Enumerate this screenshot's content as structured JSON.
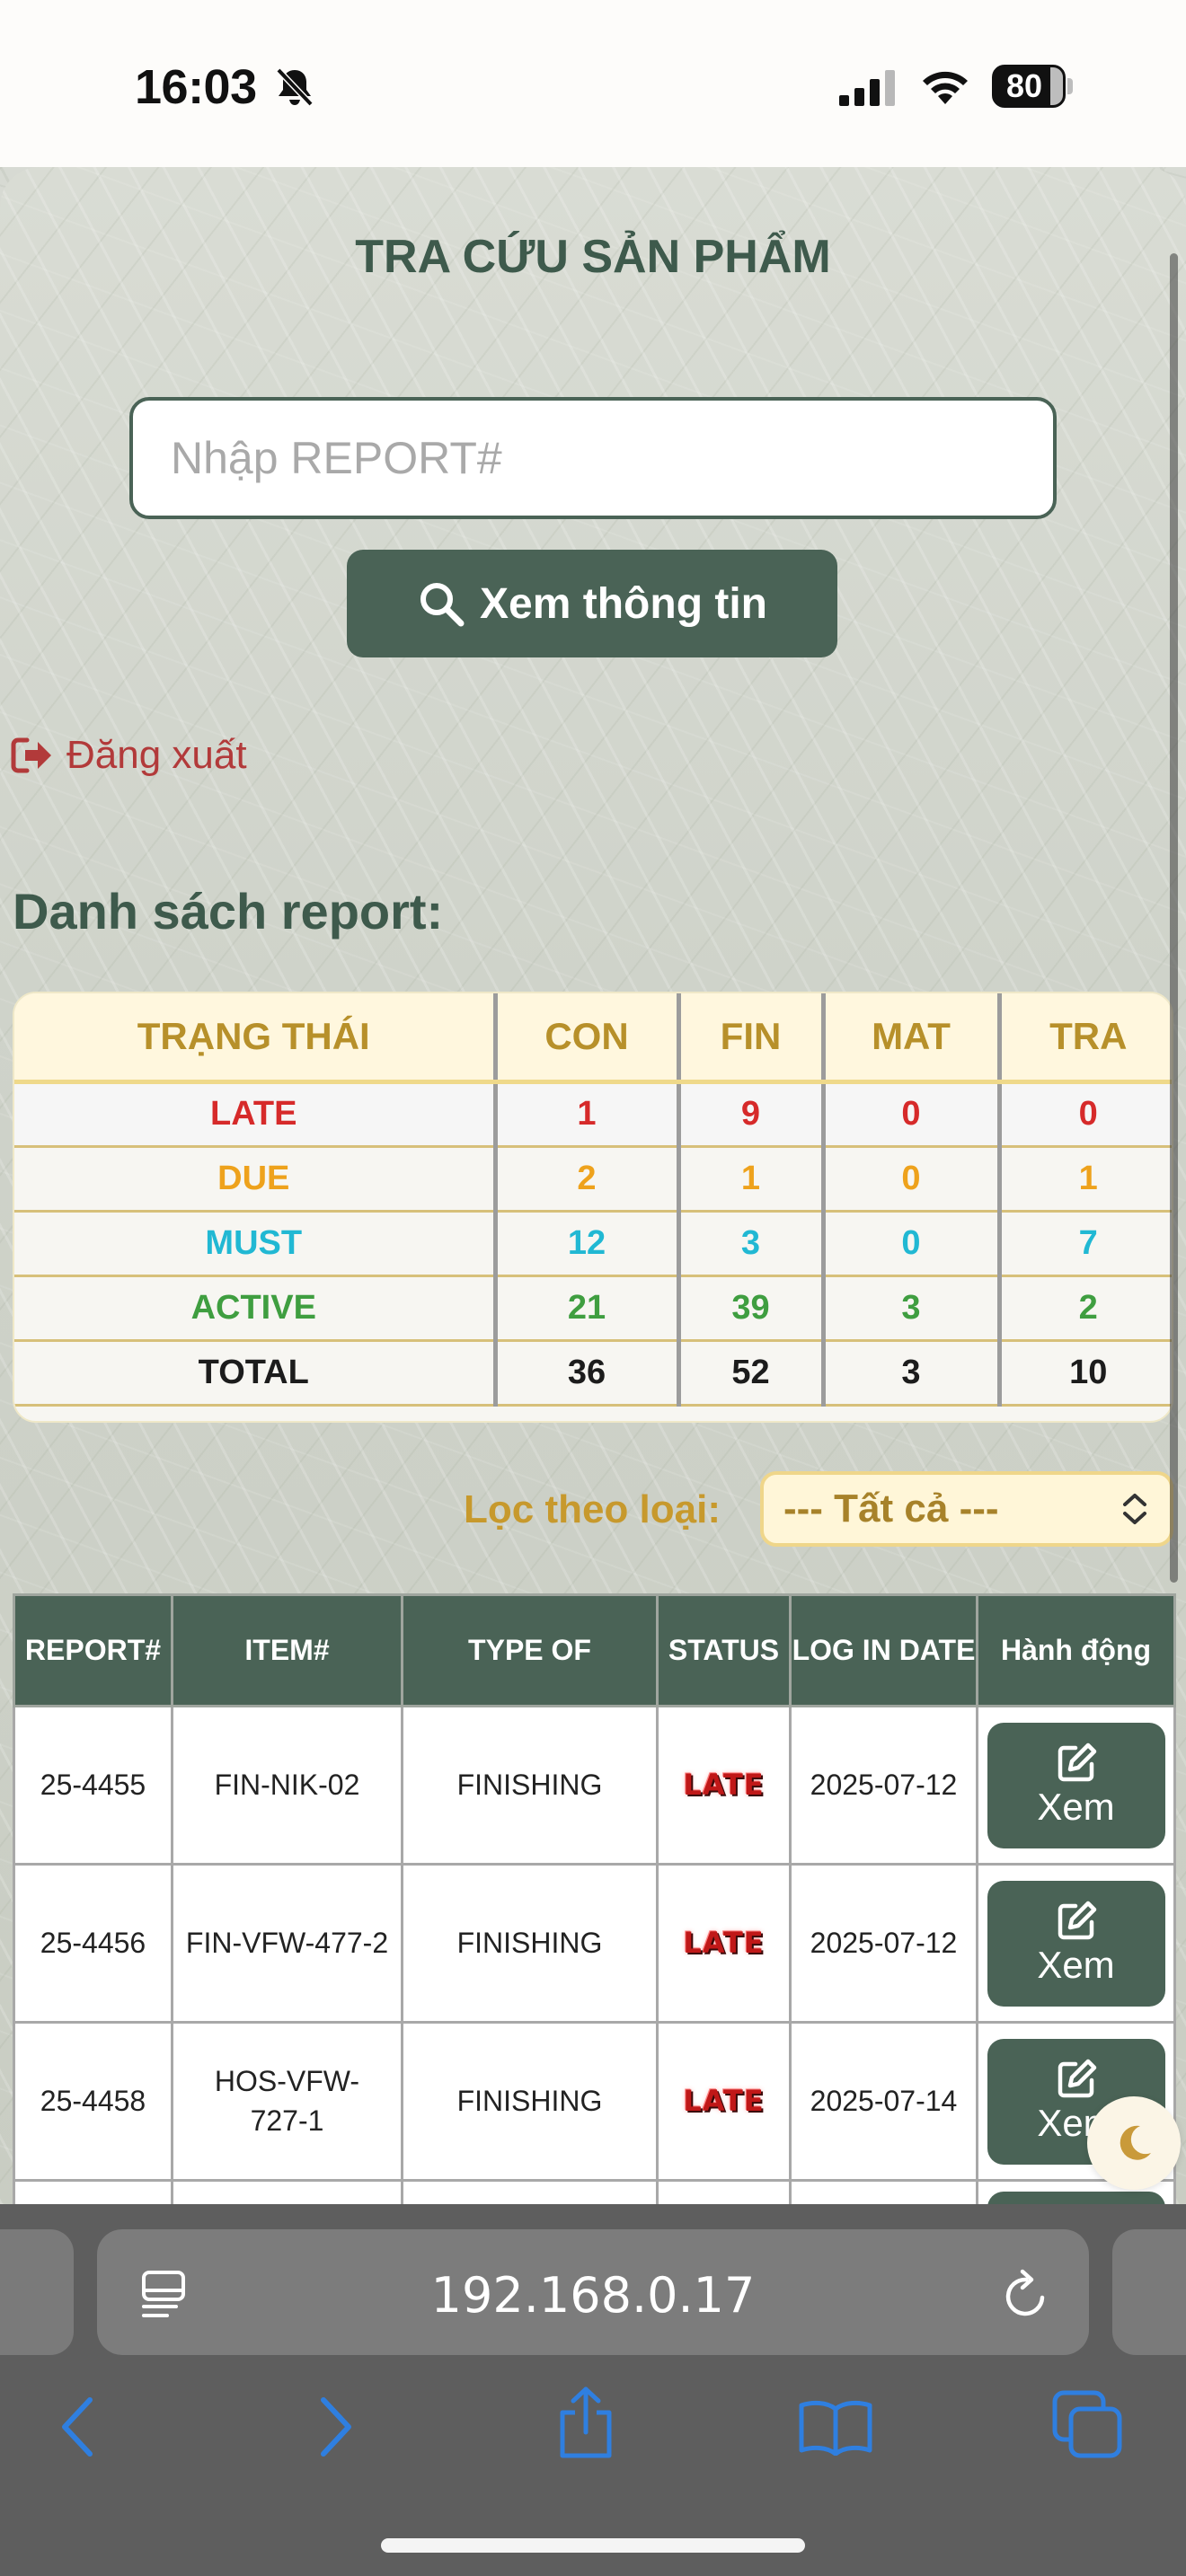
{
  "status_bar": {
    "time": "16:03",
    "battery": "80"
  },
  "header": {
    "title": "TRA CỨU SẢN PHẨM"
  },
  "search": {
    "placeholder": "Nhập REPORT#",
    "button_label": "Xem thông tin"
  },
  "logout_label": "Đăng xuất",
  "list_title": "Danh sách report:",
  "summary": {
    "headers": [
      "TRẠNG THÁI",
      "CON",
      "FIN",
      "MAT",
      "TRA"
    ],
    "rows": [
      {
        "label": "LATE",
        "color": "#d62a2a",
        "values": [
          "1",
          "9",
          "0",
          "0"
        ]
      },
      {
        "label": "DUE",
        "color": "#eea21c",
        "values": [
          "2",
          "1",
          "0",
          "1"
        ]
      },
      {
        "label": "MUST",
        "color": "#21b8d3",
        "values": [
          "12",
          "3",
          "0",
          "7"
        ]
      },
      {
        "label": "ACTIVE",
        "color": "#3f9e40",
        "values": [
          "21",
          "39",
          "3",
          "2"
        ]
      },
      {
        "label": "TOTAL",
        "color": "#1c1c1c",
        "values": [
          "36",
          "52",
          "3",
          "10"
        ]
      }
    ]
  },
  "filter": {
    "label": "Lọc theo loại:",
    "selected": "--- Tất cả ---"
  },
  "reports": {
    "headers": [
      "REPORT#",
      "ITEM#",
      "TYPE OF",
      "STATUS",
      "LOG IN DATE",
      "Hành động"
    ],
    "action_label": "Xem",
    "rows": [
      {
        "report": "25-4455",
        "item": "FIN-NIK-02",
        "type": "FINISHING",
        "status": "LATE",
        "date": "2025-07-12"
      },
      {
        "report": "25-4456",
        "item": "FIN-VFW-477-2",
        "type": "FINISHING",
        "status": "LATE",
        "date": "2025-07-12"
      },
      {
        "report": "25-4458",
        "item": "HOS-VFW-727-1",
        "type": "FINISHING",
        "status": "LATE",
        "date": "2025-07-14"
      }
    ]
  },
  "browser": {
    "url": "192.168.0.17"
  },
  "icons": {
    "bell": "bell-slash-icon",
    "signal": "cellular-signal-icon",
    "wifi": "wifi-icon",
    "search": "magnifier-icon",
    "logout": "sign-out-icon",
    "select": "chevron-up-down-icon",
    "edit": "edit-icon",
    "theme": "moon-icon",
    "back": "chevron-left-icon",
    "forward": "chevron-right-icon",
    "share": "share-icon",
    "bookmarks": "book-icon",
    "tabs": "tabs-icon"
  },
  "colors": {
    "brand_green": "#4a6356",
    "title_green": "#3e5a4c",
    "gold": "#c7992d",
    "logout_red": "#b23a3a"
  }
}
